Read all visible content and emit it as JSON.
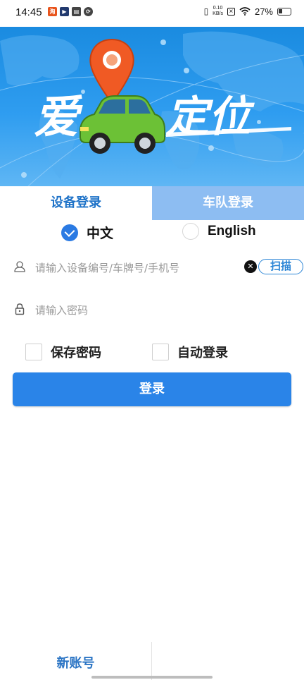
{
  "status_bar": {
    "time": "14:45",
    "net_speed_value": "0.10",
    "net_speed_unit": "KB/s",
    "battery_percent": "27%"
  },
  "banner": {
    "char_left": "爱",
    "char_right": "定位"
  },
  "tabs": [
    {
      "label": "设备登录",
      "active": true
    },
    {
      "label": "车队登录",
      "active": false
    }
  ],
  "language": {
    "options": [
      {
        "label": "中文",
        "selected": true
      },
      {
        "label": "English",
        "selected": false
      }
    ]
  },
  "form": {
    "account_placeholder": "请输入设备编号/车牌号/手机号",
    "password_placeholder": "请输入密码",
    "scan_label": "扫描",
    "clear_symbol": "✕",
    "save_password_label": "保存密码",
    "auto_login_label": "自动登录",
    "login_label": "登录"
  },
  "footer": {
    "new_account_label": "新账号"
  },
  "colors": {
    "accent": "#2a84e8",
    "tab_inactive": "#8dbdf2",
    "tab_active_text": "#1f73c8"
  },
  "icons": [
    "vibrate-icon",
    "wifi-icon",
    "battery-icon",
    "user-icon",
    "lock-icon",
    "location-pin-icon",
    "car-icon"
  ]
}
